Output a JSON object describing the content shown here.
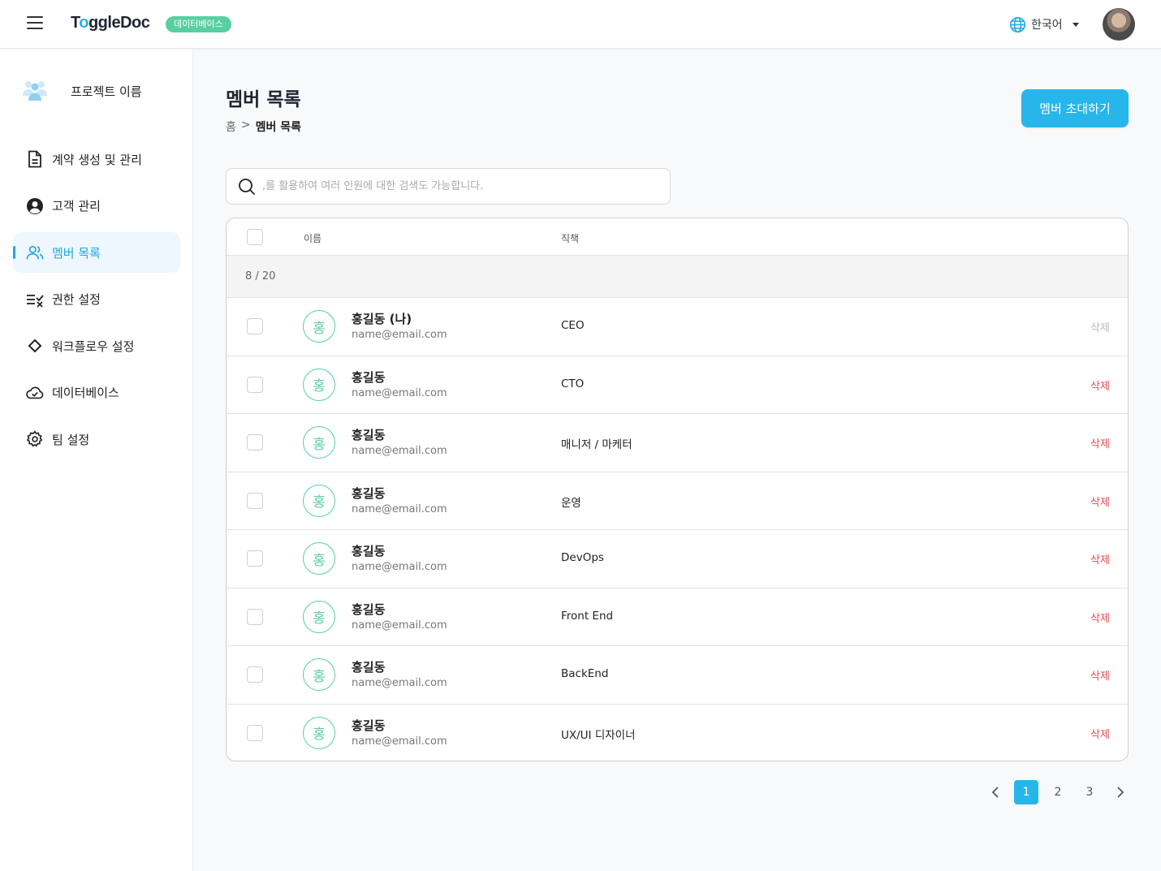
{
  "header": {
    "logo_pre": "T",
    "logo_o": "o",
    "logo_post": "ggleDoc",
    "badge": "데이터베이스",
    "language": "한국어"
  },
  "sidebar": {
    "project_name": "프로젝트 이름",
    "items": [
      {
        "label": "계약 생성 및 관리",
        "icon": "document-icon"
      },
      {
        "label": "고객 관리",
        "icon": "user-circle-icon"
      },
      {
        "label": "멤버 목록",
        "icon": "users-icon",
        "active": true
      },
      {
        "label": "권한 설정",
        "icon": "permission-list-icon"
      },
      {
        "label": "워크플로우 설정",
        "icon": "diamond-icon"
      },
      {
        "label": "데이터베이스",
        "icon": "cloud-check-icon"
      },
      {
        "label": "팀 설정",
        "icon": "gear-icon"
      }
    ]
  },
  "main": {
    "title": "멤버 목록",
    "breadcrumb": {
      "home": "홈",
      "separator": ">",
      "current": "멤버 목록"
    },
    "invite_button": "멤버 초대하기",
    "search_placeholder": ",를 활용하여 여러 인원에 대한 검색도 가능합니다."
  },
  "table": {
    "columns": {
      "name": "이름",
      "role": "직책"
    },
    "count": "8 / 20",
    "delete_label": "삭제",
    "rows": [
      {
        "avatar": "홍",
        "name": "홍길동 (나)",
        "email": "name@email.com",
        "role": "CEO",
        "deletable": false
      },
      {
        "avatar": "홍",
        "name": "홍길동",
        "email": "name@email.com",
        "role": "CTO",
        "deletable": true
      },
      {
        "avatar": "홍",
        "name": "홍길동",
        "email": "name@email.com",
        "role": "매니저 / 마케터",
        "deletable": true
      },
      {
        "avatar": "홍",
        "name": "홍길동",
        "email": "name@email.com",
        "role": "운영",
        "deletable": true
      },
      {
        "avatar": "홍",
        "name": "홍길동",
        "email": "name@email.com",
        "role": "DevOps",
        "deletable": true
      },
      {
        "avatar": "홍",
        "name": "홍길동",
        "email": "name@email.com",
        "role": "Front End",
        "deletable": true
      },
      {
        "avatar": "홍",
        "name": "홍길동",
        "email": "name@email.com",
        "role": "BackEnd",
        "deletable": true
      },
      {
        "avatar": "홍",
        "name": "홍길동",
        "email": "name@email.com",
        "role": "UX/UI 디자이너",
        "deletable": true
      }
    ]
  },
  "pagination": {
    "pages": [
      "1",
      "2",
      "3"
    ],
    "current": "1"
  },
  "colors": {
    "accent": "#26b6ec",
    "badge": "#58cfa3",
    "delete": "#e84a57"
  }
}
